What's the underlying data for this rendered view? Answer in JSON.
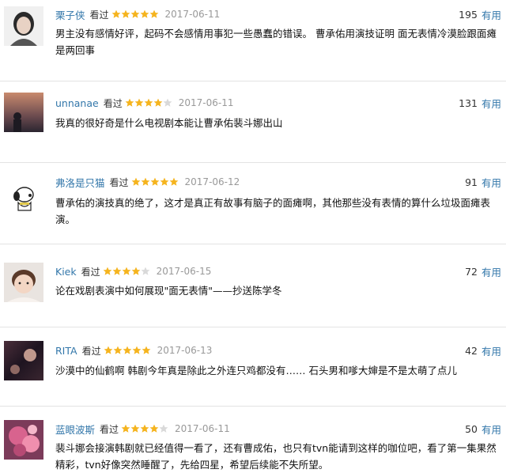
{
  "colors": {
    "link": "#3377aa",
    "star": "#f5b41e",
    "star_empty": "#d9d9d9",
    "date": "#999999"
  },
  "useful_label": "有用",
  "watched_label": "看过",
  "reviews": [
    {
      "user": "栗子侠",
      "rating": 5,
      "date": "2017-06-11",
      "votes": "195",
      "text": "男主没有感情好评，起码不会感情用事犯一些愚蠢的错误。 曹承佑用演技证明 面无表情冷漠脸跟面瘫是两回事"
    },
    {
      "user": "unnanae",
      "rating": 4,
      "date": "2017-06-11",
      "votes": "131",
      "text": "我真的很好奇是什么电视剧本能让曹承佑裴斗娜出山"
    },
    {
      "user": "弗洛是只猫",
      "rating": 5,
      "date": "2017-06-12",
      "votes": "91",
      "text": "曹承佑的演技真的绝了，这才是真正有故事有脑子的面瘫啊，其他那些没有表情的算什么垃圾面瘫表演。"
    },
    {
      "user": "Kiek",
      "rating": 4,
      "date": "2017-06-15",
      "votes": "72",
      "text": "论在戏剧表演中如何展现\"面无表情\"——抄送陈学冬"
    },
    {
      "user": "RITA",
      "rating": 5,
      "date": "2017-06-13",
      "votes": "42",
      "text": "沙漠中的仙鹤啊 韩剧今年真是除此之外连只鸡都没有…… 石头男和嗲大婶是不是太萌了点儿"
    },
    {
      "user": "蓝眼波斯",
      "rating": 4,
      "date": "2017-06-11",
      "votes": "50",
      "text": "裴斗娜会接演韩剧就已经值得一看了，还有曹成佑，也只有tvn能请到这样的咖位吧，看了第一集果然精彩，tvn好像突然睡醒了，先给四星，希望后续能不失所望。"
    }
  ]
}
